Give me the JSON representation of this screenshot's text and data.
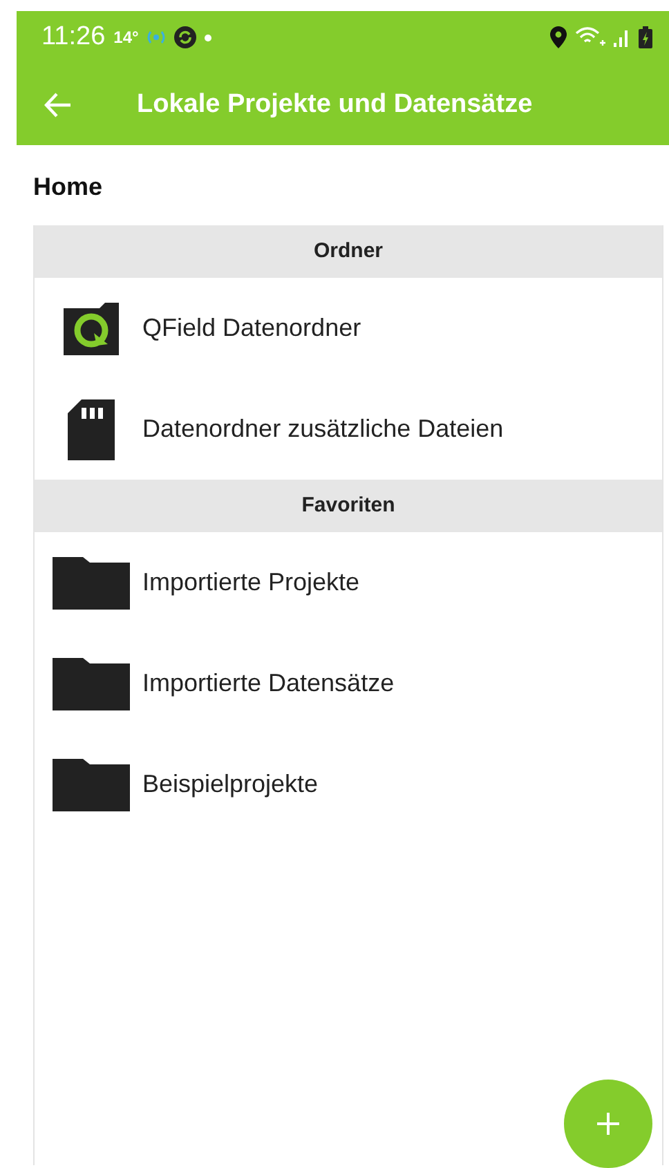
{
  "status_bar": {
    "time": "11:26",
    "temperature": "14°"
  },
  "app_bar": {
    "title": "Lokale Projekte und Datensätze"
  },
  "breadcrumb": "Home",
  "sections": [
    {
      "title": "Ordner",
      "items": [
        {
          "label": "QField Datenordner",
          "kind": "qfield"
        },
        {
          "label": "Datenordner zusätzliche Dateien",
          "kind": "sdcard"
        }
      ]
    },
    {
      "title": "Favoriten",
      "items": [
        {
          "label": "Importierte Projekte",
          "kind": "folder"
        },
        {
          "label": "Importierte Datensätze",
          "kind": "folder"
        },
        {
          "label": "Beispielprojekte",
          "kind": "folder"
        }
      ]
    }
  ]
}
